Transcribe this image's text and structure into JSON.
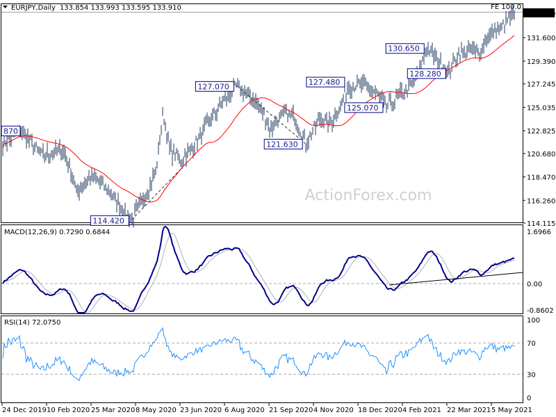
{
  "header": {
    "symbol_timeframe": "EURJPY,Daily",
    "ohlc": "133.854 133.993 133.595 133.910",
    "fe_label": "FE 100.0"
  },
  "watermark": "ActionForex.com",
  "colors": {
    "bars": "#1f3a5f",
    "ma": "#ff0000",
    "macd": "#00008b",
    "signal": "#b0b0b0",
    "rsi": "#1e90ff",
    "label_border": "#00008b",
    "price_tag_bg": "#000000"
  },
  "chart_data": [
    {
      "type": "bar",
      "title": "EURJPY,Daily",
      "current_price": "133.910",
      "y_ticks": [
        "133.910",
        "131.600",
        "129.390",
        "127.245",
        "125.035",
        "122.825",
        "120.680",
        "118.470",
        "116.260",
        "114.115"
      ],
      "ylim": [
        114.115,
        133.91
      ],
      "x_ticks": [
        "24 Dec 2019",
        "10 Feb 2020",
        "25 Mar 2020",
        "8 May 2020",
        "23 Jun 2020",
        "6 Aug 2020",
        "21 Sep 2020",
        "4 Nov 2020",
        "18 Dec 2020",
        "4 Feb 2021",
        "22 Mar 2021",
        "5 May 2021"
      ],
      "series_approx_close": [
        [
          "2019-12-23",
          121.5
        ],
        [
          "2020-01-12",
          122.9
        ],
        [
          "2020-02-02",
          120.5
        ],
        [
          "2020-02-24",
          121.0
        ],
        [
          "2020-03-02",
          119.5
        ],
        [
          "2020-03-09",
          117.0
        ],
        [
          "2020-03-23",
          118.5
        ],
        [
          "2020-04-02",
          118.0
        ],
        [
          "2020-04-16",
          116.5
        ],
        [
          "2020-05-04",
          114.4
        ],
        [
          "2020-05-19",
          117.0
        ],
        [
          "2020-05-29",
          119.0
        ],
        [
          "2020-06-05",
          124.5
        ],
        [
          "2020-06-12",
          121.0
        ],
        [
          "2020-06-23",
          120.0
        ],
        [
          "2020-07-07",
          121.5
        ],
        [
          "2020-07-21",
          123.5
        ],
        [
          "2020-08-04",
          125.5
        ],
        [
          "2020-08-19",
          127.0
        ],
        [
          "2020-09-02",
          126.0
        ],
        [
          "2020-09-12",
          125.0
        ],
        [
          "2020-09-23",
          123.0
        ],
        [
          "2020-10-07",
          124.5
        ],
        [
          "2020-10-18",
          124.0
        ],
        [
          "2020-10-28",
          121.6
        ],
        [
          "2020-11-12",
          124.0
        ],
        [
          "2020-11-22",
          123.5
        ],
        [
          "2020-12-03",
          125.0
        ],
        [
          "2020-12-10",
          127.0
        ],
        [
          "2020-12-24",
          127.2
        ],
        [
          "2021-01-07",
          126.5
        ],
        [
          "2021-01-18",
          125.1
        ],
        [
          "2021-01-28",
          125.8
        ],
        [
          "2021-02-12",
          127.0
        ],
        [
          "2021-02-19",
          128.0
        ],
        [
          "2021-03-01",
          130.6
        ],
        [
          "2021-03-12",
          129.5
        ],
        [
          "2021-03-23",
          128.3
        ],
        [
          "2021-04-02",
          130.0
        ],
        [
          "2021-04-16",
          130.5
        ],
        [
          "2021-04-23",
          130.0
        ],
        [
          "2021-04-30",
          131.5
        ],
        [
          "2021-05-15",
          132.5
        ],
        [
          "2021-05-29",
          133.9
        ]
      ],
      "annotations": [
        {
          "text": "870",
          "date": "2019-12-25",
          "price": 122.87
        },
        {
          "text": "114.420",
          "date": "2020-05-04",
          "price": 114.42
        },
        {
          "text": "127.070",
          "date": "2020-08-19",
          "price": 127.07
        },
        {
          "text": "121.630",
          "date": "2020-10-28",
          "price": 121.63
        },
        {
          "text": "127.480",
          "date": "2020-12-10",
          "price": 127.48
        },
        {
          "text": "125.070",
          "date": "2021-01-18",
          "price": 125.07
        },
        {
          "text": "130.650",
          "date": "2021-03-01",
          "price": 130.65
        },
        {
          "text": "128.280",
          "date": "2021-03-23",
          "price": 128.28
        }
      ],
      "moving_average": "red line"
    },
    {
      "type": "line",
      "title": "MACD(12,26,9) 0.7290 0.6844",
      "y_ticks": [
        "1.6966",
        "0.00",
        "-0.8602"
      ],
      "ylim": [
        -0.8602,
        1.6966
      ]
    },
    {
      "type": "line",
      "title": "RSI(14) 72.0750",
      "y_ticks": [
        "100",
        "70",
        "30",
        "0"
      ],
      "ylim": [
        0,
        100
      ]
    }
  ]
}
